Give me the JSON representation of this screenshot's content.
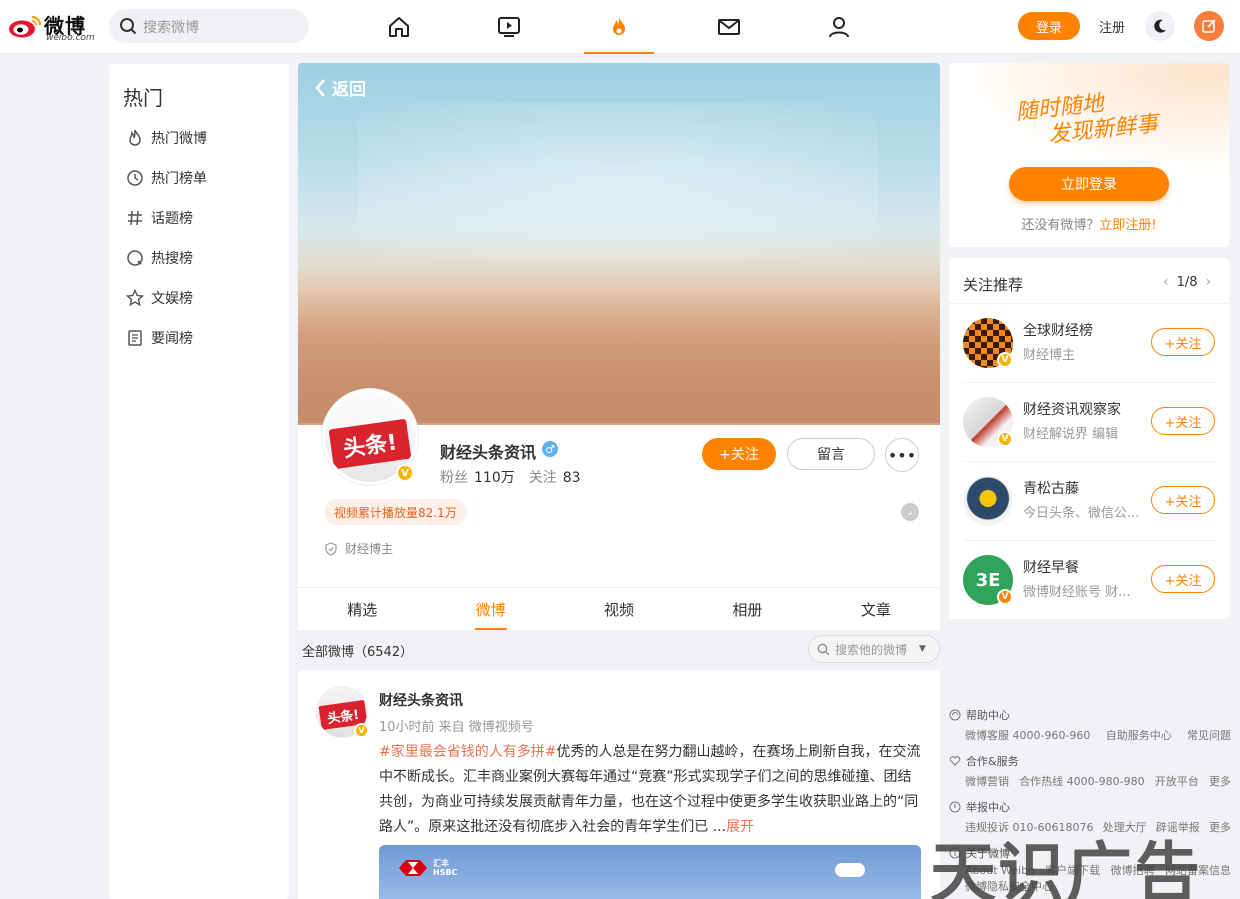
{
  "header": {
    "logo_cn": "微博",
    "logo_en": "weibo.com",
    "search_placeholder": "搜索微博",
    "nav_icons": [
      "home-icon",
      "video-icon",
      "hot-icon",
      "mail-icon",
      "profile-icon"
    ],
    "active_nav": "hot-icon",
    "login_label": "登录",
    "register_label": "注册"
  },
  "sidebar": {
    "title": "热门",
    "items": [
      {
        "label": "热门微博",
        "icon": "flame-icon"
      },
      {
        "label": "热门榜单",
        "icon": "clock-icon"
      },
      {
        "label": "话题榜",
        "icon": "hashtag-icon"
      },
      {
        "label": "热搜榜",
        "icon": "search-rank-icon"
      },
      {
        "label": "文娱榜",
        "icon": "star-icon"
      },
      {
        "label": "要闻榜",
        "icon": "news-icon"
      }
    ]
  },
  "profile": {
    "back_label": "返回",
    "avatar_text": "头条!",
    "name": "财经头条资讯",
    "gender_symbol": "♂",
    "fans_label": "粉丝",
    "fans_value": "110万",
    "following_label": "关注",
    "following_value": "83",
    "follow_button": "+关注",
    "message_button": "留言",
    "more_button": "•••",
    "play_tag": "视频累计播放量82.1万",
    "role": "财经博主",
    "tabs": [
      "精选",
      "微博",
      "视频",
      "相册",
      "文章"
    ],
    "active_tab": "微博"
  },
  "feed": {
    "all_label": "全部微博（6542）",
    "search_placeholder": "搜索他的微博",
    "post": {
      "author": "财经头条资讯",
      "meta": "10小时前  来自 微博视频号",
      "topic": "#家里最会省钱的人有多拼#",
      "text": "优秀的人总是在努力翻山越岭，在赛场上刷新自我，在交流中不断成长。汇丰商业案例大赛每年通过“竞赛”形式实现学子们之间的思维碰撞、团结共创，为商业可持续发展贡献青年力量，也在这个过程中使更多学生收获职业路上的“同路人”。原来这批还没有彻底步入社会的青年学生们已  ...",
      "expand": "展开",
      "image_brand": "汇丰\nHSBC"
    }
  },
  "login_card": {
    "slogan_line1": "随时随地",
    "slogan_line2": "发现新鲜事",
    "button": "立即登录",
    "prompt": "还没有微博？",
    "register_link": "立即注册!"
  },
  "recommend": {
    "title": "关注推荐",
    "page": "1/8",
    "follow_label": "+关注",
    "items": [
      {
        "name": "全球财经榜",
        "desc": "财经博主",
        "badge": "V"
      },
      {
        "name": "财经资讯观察家",
        "desc": "财经解说界 编辑",
        "badge": "V"
      },
      {
        "name": "青松古藤",
        "desc": "今日头条、微信公...",
        "badge": ""
      },
      {
        "name": "财经早餐",
        "desc": "微博财经账号 财...",
        "badge": "V"
      }
    ]
  },
  "footer": {
    "groups": [
      {
        "head": "帮助中心",
        "links": [
          "微博客服 4000-960-960",
          "自助服务中心",
          "常见问题"
        ]
      },
      {
        "head": "合作&服务",
        "links": [
          "微博营销",
          "合作热线 4000-980-980",
          "开放平台",
          "更多"
        ]
      },
      {
        "head": "举报中心",
        "links": [
          "违规投诉 010-60618076",
          "处理大厅",
          "辟谣举报",
          "更多"
        ]
      },
      {
        "head": "关于微博",
        "links": [
          "About Weibo",
          "客户端下载",
          "微博招聘",
          "网站备案信息"
        ]
      }
    ],
    "last_line": "微博隐私安全中心"
  },
  "watermark": "天识广告",
  "colors": {
    "accent": "#ff8200",
    "topic": "#eb7350",
    "verify": "#f7b500"
  }
}
